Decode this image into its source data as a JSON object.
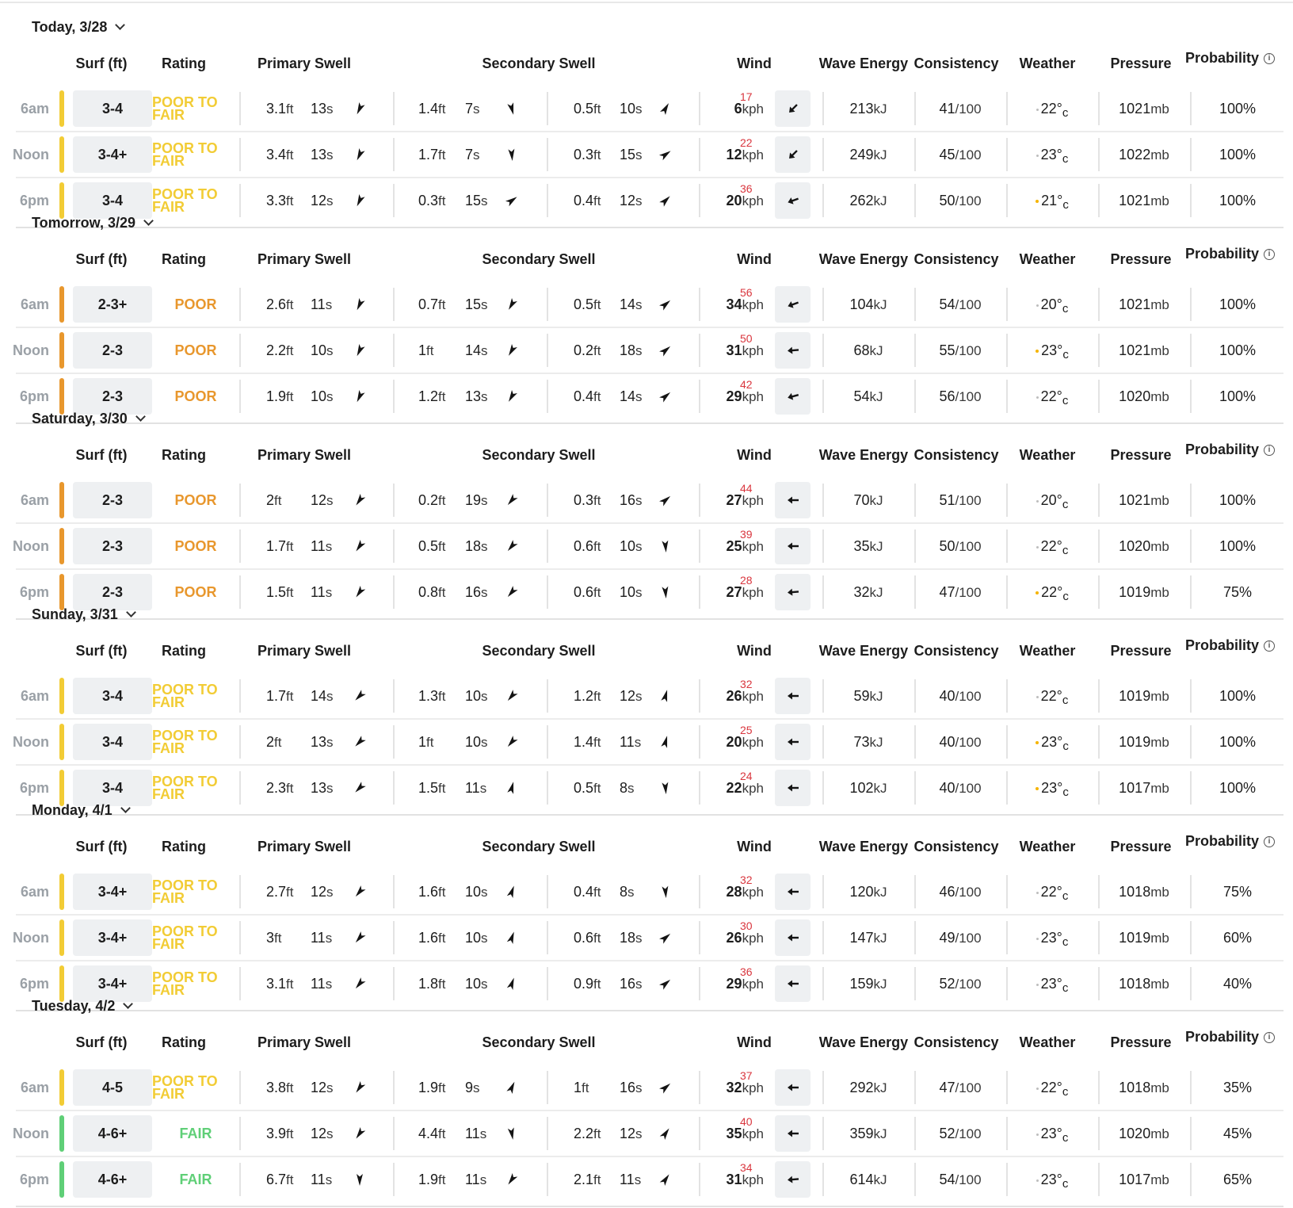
{
  "columns": {
    "surf": "Surf (ft)",
    "rating": "Rating",
    "primary": "Primary Swell",
    "secondary": "Secondary Swell",
    "wind": "Wind",
    "energy": "Wave Energy",
    "consistency": "Consistency",
    "weather": "Weather",
    "pressure": "Pressure",
    "probability": "Probability"
  },
  "units": {
    "ft": "ft",
    "s": "s",
    "kph": "kph",
    "kj": "kJ",
    "of100": "/100",
    "mb": "mb",
    "c": "c"
  },
  "colors": {
    "poor_to_fair": "#f2cc35",
    "poor": "#e8972d",
    "fair": "#5fcf77",
    "gust": "#d9363e"
  },
  "icons": {
    "chevron": "chevron-down-icon",
    "info": "info-icon",
    "swell": "swell-direction-icon",
    "wind": "wind-arrow-icon",
    "weather": "weather-icon"
  },
  "days": [
    {
      "title": "Today, 3/28",
      "rows": [
        {
          "time": "6am",
          "surf": "3-4",
          "rating": "POOR TO FAIR",
          "rk": "poor_to_fair",
          "p": [
            "3.1",
            "13",
            205
          ],
          "s1": [
            "1.4",
            "7",
            165
          ],
          "s2": [
            "0.5",
            "10",
            30
          ],
          "wind": "6",
          "gust": "17",
          "wa": 225,
          "energy": "213",
          "cons": "41",
          "weather": "22°",
          "wx": "cloud",
          "pressure": "1021",
          "prob": "100%"
        },
        {
          "time": "Noon",
          "surf": "3-4+",
          "rating": "POOR TO FAIR",
          "rk": "poor_to_fair",
          "p": [
            "3.4",
            "13",
            205
          ],
          "s1": [
            "1.7",
            "7",
            175
          ],
          "s2": [
            "0.3",
            "15",
            55
          ],
          "wind": "12",
          "gust": "22",
          "wa": 225,
          "energy": "249",
          "cons": "45",
          "weather": "23°",
          "wx": "cloud",
          "pressure": "1022",
          "prob": "100%"
        },
        {
          "time": "6pm",
          "surf": "3-4",
          "rating": "POOR TO FAIR",
          "rk": "poor_to_fair",
          "p": [
            "3.3",
            "12",
            205
          ],
          "s1": [
            "0.3",
            "15",
            55
          ],
          "s2": [
            "0.4",
            "12",
            45
          ],
          "wind": "20",
          "gust": "36",
          "wa": 250,
          "energy": "262",
          "cons": "50",
          "weather": "21°",
          "wx": "sun",
          "pressure": "1021",
          "prob": "100%"
        }
      ]
    },
    {
      "title": "Tomorrow, 3/29",
      "rows": [
        {
          "time": "6am",
          "surf": "2-3+",
          "rating": "POOR",
          "rk": "poor",
          "p": [
            "2.6",
            "11",
            205
          ],
          "s1": [
            "0.7",
            "15",
            210
          ],
          "s2": [
            "0.5",
            "14",
            50
          ],
          "wind": "34",
          "gust": "56",
          "wa": 250,
          "energy": "104",
          "cons": "54",
          "weather": "20°",
          "wx": "cloud",
          "pressure": "1021",
          "prob": "100%"
        },
        {
          "time": "Noon",
          "surf": "2-3",
          "rating": "POOR",
          "rk": "poor",
          "p": [
            "2.2",
            "10",
            205
          ],
          "s1": [
            "1",
            "14",
            210
          ],
          "s2": [
            "0.2",
            "18",
            50
          ],
          "wind": "31",
          "gust": "50",
          "wa": 265,
          "energy": "68",
          "cons": "55",
          "weather": "23°",
          "wx": "sun",
          "pressure": "1021",
          "prob": "100%"
        },
        {
          "time": "6pm",
          "surf": "2-3",
          "rating": "POOR",
          "rk": "poor",
          "p": [
            "1.9",
            "10",
            205
          ],
          "s1": [
            "1.2",
            "13",
            210
          ],
          "s2": [
            "0.4",
            "14",
            50
          ],
          "wind": "29",
          "gust": "42",
          "wa": 255,
          "energy": "54",
          "cons": "56",
          "weather": "22°",
          "wx": "cloud",
          "pressure": "1020",
          "prob": "100%"
        }
      ]
    },
    {
      "title": "Saturday, 3/30",
      "rows": [
        {
          "time": "6am",
          "surf": "2-3",
          "rating": "POOR",
          "rk": "poor",
          "p": [
            "2",
            "12",
            215
          ],
          "s1": [
            "0.2",
            "19",
            220
          ],
          "s2": [
            "0.3",
            "16",
            50
          ],
          "wind": "27",
          "gust": "44",
          "wa": 270,
          "energy": "70",
          "cons": "51",
          "weather": "20°",
          "wx": "cloud",
          "pressure": "1021",
          "prob": "100%"
        },
        {
          "time": "Noon",
          "surf": "2-3",
          "rating": "POOR",
          "rk": "poor",
          "p": [
            "1.7",
            "11",
            215
          ],
          "s1": [
            "0.5",
            "18",
            220
          ],
          "s2": [
            "0.6",
            "10",
            175
          ],
          "wind": "25",
          "gust": "39",
          "wa": 270,
          "energy": "35",
          "cons": "50",
          "weather": "22°",
          "wx": "cloud",
          "pressure": "1020",
          "prob": "100%"
        },
        {
          "time": "6pm",
          "surf": "2-3",
          "rating": "POOR",
          "rk": "poor",
          "p": [
            "1.5",
            "11",
            215
          ],
          "s1": [
            "0.8",
            "16",
            220
          ],
          "s2": [
            "0.6",
            "10",
            175
          ],
          "wind": "27",
          "gust": "28",
          "wa": 265,
          "energy": "32",
          "cons": "47",
          "weather": "22°",
          "wx": "sun",
          "pressure": "1019",
          "prob": "75%"
        }
      ]
    },
    {
      "title": "Sunday, 3/31",
      "rows": [
        {
          "time": "6am",
          "surf": "3-4",
          "rating": "POOR TO FAIR",
          "rk": "poor_to_fair",
          "p": [
            "1.7",
            "14",
            225
          ],
          "s1": [
            "1.3",
            "10",
            220
          ],
          "s2": [
            "1.2",
            "12",
            15
          ],
          "wind": "26",
          "gust": "32",
          "wa": 270,
          "energy": "59",
          "cons": "40",
          "weather": "22°",
          "wx": "cloud",
          "pressure": "1019",
          "prob": "100%"
        },
        {
          "time": "Noon",
          "surf": "3-4",
          "rating": "POOR TO FAIR",
          "rk": "poor_to_fair",
          "p": [
            "2",
            "13",
            225
          ],
          "s1": [
            "1",
            "10",
            220
          ],
          "s2": [
            "1.4",
            "11",
            15
          ],
          "wind": "20",
          "gust": "25",
          "wa": 270,
          "energy": "73",
          "cons": "40",
          "weather": "23°",
          "wx": "sun",
          "pressure": "1019",
          "prob": "100%"
        },
        {
          "time": "6pm",
          "surf": "3-4",
          "rating": "POOR TO FAIR",
          "rk": "poor_to_fair",
          "p": [
            "2.3",
            "13",
            225
          ],
          "s1": [
            "1.5",
            "11",
            15
          ],
          "s2": [
            "0.5",
            "8",
            175
          ],
          "wind": "22",
          "gust": "24",
          "wa": 270,
          "energy": "102",
          "cons": "40",
          "weather": "23°",
          "wx": "sun",
          "pressure": "1017",
          "prob": "100%"
        }
      ]
    },
    {
      "title": "Monday, 4/1",
      "rows": [
        {
          "time": "6am",
          "surf": "3-4+",
          "rating": "POOR TO FAIR",
          "rk": "poor_to_fair",
          "p": [
            "2.7",
            "12",
            220
          ],
          "s1": [
            "1.6",
            "10",
            20
          ],
          "s2": [
            "0.4",
            "8",
            175
          ],
          "wind": "28",
          "gust": "32",
          "wa": 270,
          "energy": "120",
          "cons": "46",
          "weather": "22°",
          "wx": "cloud",
          "pressure": "1018",
          "prob": "75%"
        },
        {
          "time": "Noon",
          "surf": "3-4+",
          "rating": "POOR TO FAIR",
          "rk": "poor_to_fair",
          "p": [
            "3",
            "11",
            220
          ],
          "s1": [
            "1.6",
            "10",
            20
          ],
          "s2": [
            "0.6",
            "18",
            50
          ],
          "wind": "26",
          "gust": "30",
          "wa": 270,
          "energy": "147",
          "cons": "49",
          "weather": "23°",
          "wx": "cloud",
          "pressure": "1019",
          "prob": "60%"
        },
        {
          "time": "6pm",
          "surf": "3-4+",
          "rating": "POOR TO FAIR",
          "rk": "poor_to_fair",
          "p": [
            "3.1",
            "11",
            220
          ],
          "s1": [
            "1.8",
            "10",
            20
          ],
          "s2": [
            "0.9",
            "16",
            50
          ],
          "wind": "29",
          "gust": "36",
          "wa": 270,
          "energy": "159",
          "cons": "52",
          "weather": "23°",
          "wx": "cloud",
          "pressure": "1018",
          "prob": "40%"
        }
      ]
    },
    {
      "title": "Tuesday, 4/2",
      "rows": [
        {
          "time": "6am",
          "surf": "4-5",
          "rating": "POOR TO FAIR",
          "rk": "poor_to_fair",
          "p": [
            "3.8",
            "12",
            215
          ],
          "s1": [
            "1.9",
            "9",
            25
          ],
          "s2": [
            "1",
            "16",
            50
          ],
          "wind": "32",
          "gust": "37",
          "wa": 270,
          "energy": "292",
          "cons": "47",
          "weather": "22°",
          "wx": "cloud",
          "pressure": "1018",
          "prob": "35%"
        },
        {
          "time": "Noon",
          "surf": "4-6+",
          "rating": "FAIR",
          "rk": "fair",
          "p": [
            "3.9",
            "12",
            215
          ],
          "s1": [
            "4.4",
            "11",
            170
          ],
          "s2": [
            "2.2",
            "12",
            35
          ],
          "wind": "35",
          "gust": "40",
          "wa": 270,
          "energy": "359",
          "cons": "52",
          "weather": "23°",
          "wx": "cloud",
          "pressure": "1020",
          "prob": "45%"
        },
        {
          "time": "6pm",
          "surf": "4-6+",
          "rating": "FAIR",
          "rk": "fair",
          "p": [
            "6.7",
            "11",
            180
          ],
          "s1": [
            "1.9",
            "11",
            215
          ],
          "s2": [
            "2.1",
            "11",
            35
          ],
          "wind": "31",
          "gust": "34",
          "wa": 265,
          "energy": "614",
          "cons": "54",
          "weather": "23°",
          "wx": "cloud",
          "pressure": "1017",
          "prob": "65%"
        }
      ]
    }
  ]
}
